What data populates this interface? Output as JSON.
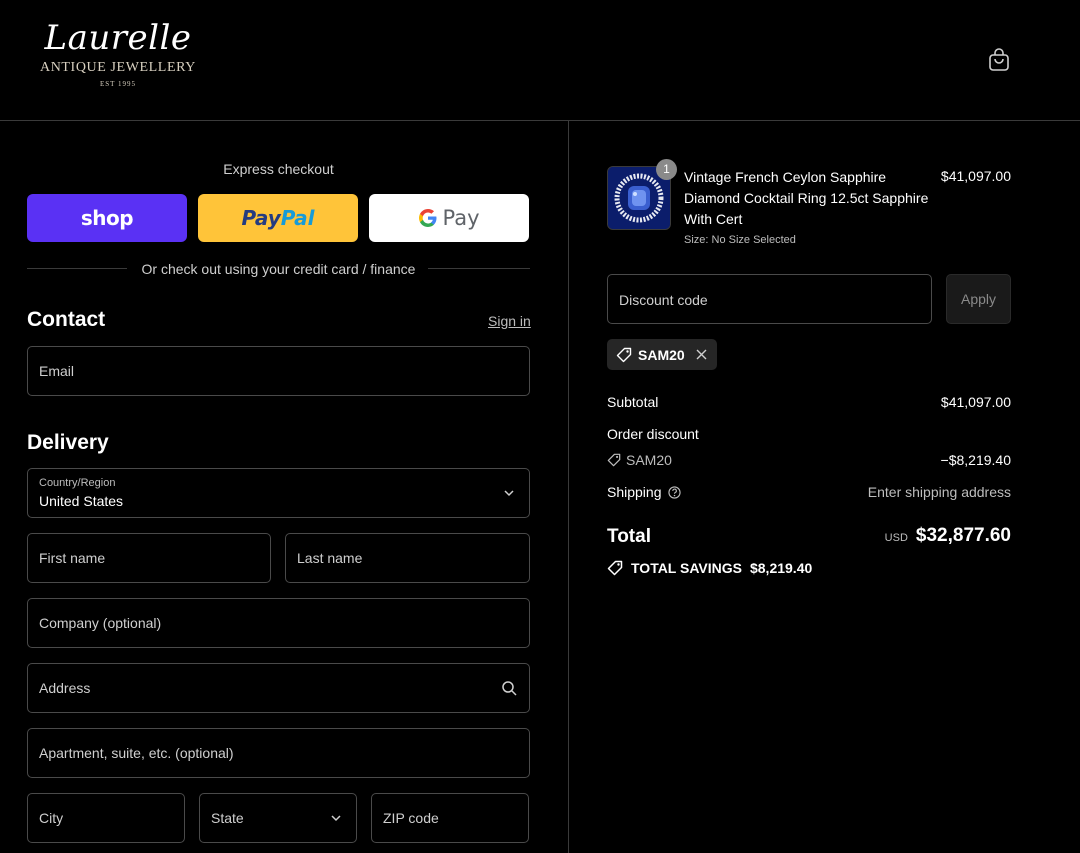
{
  "brand": {
    "script": "Laurelle",
    "sub": "ANTIQUE JEWELLERY",
    "est": "EST 1995"
  },
  "header": {
    "cart_icon": "shopping-bag-icon"
  },
  "express": {
    "label": "Express checkout",
    "shop_label": "shop",
    "paypal_dark": "Pay",
    "paypal_light": "Pal",
    "gpay_label": "Pay",
    "or_text": "Or check out using your credit card / finance"
  },
  "contact": {
    "title": "Contact",
    "sign_in": "Sign in",
    "email_placeholder": "Email"
  },
  "delivery": {
    "title": "Delivery",
    "country_label": "Country/Region",
    "country_value": "United States",
    "first_name": "First name",
    "last_name": "Last name",
    "company": "Company (optional)",
    "address": "Address",
    "apartment": "Apartment, suite, etc. (optional)",
    "city": "City",
    "state": "State",
    "zip": "ZIP code"
  },
  "order": {
    "quantity": "1",
    "product_name": "Vintage French Ceylon Sapphire Diamond Cocktail Ring 12.5ct Sapphire With Cert",
    "product_size": "Size: No Size Selected",
    "product_price": "$41,097.00",
    "discount_placeholder": "Discount code",
    "apply_label": "Apply",
    "applied_code": "SAM20",
    "subtotal_label": "Subtotal",
    "subtotal_value": "$41,097.00",
    "order_discount_label": "Order discount",
    "discount_code": "SAM20",
    "discount_value": "−$8,219.40",
    "shipping_label": "Shipping",
    "shipping_value": "Enter shipping address",
    "total_label": "Total",
    "total_currency": "USD",
    "total_value": "$32,877.60",
    "savings_label": "TOTAL SAVINGS",
    "savings_value": "$8,219.40"
  },
  "colors": {
    "background": "#000000",
    "shop_pay": "#5a31f4",
    "paypal": "#ffc439",
    "border": "#4a4a4a"
  }
}
